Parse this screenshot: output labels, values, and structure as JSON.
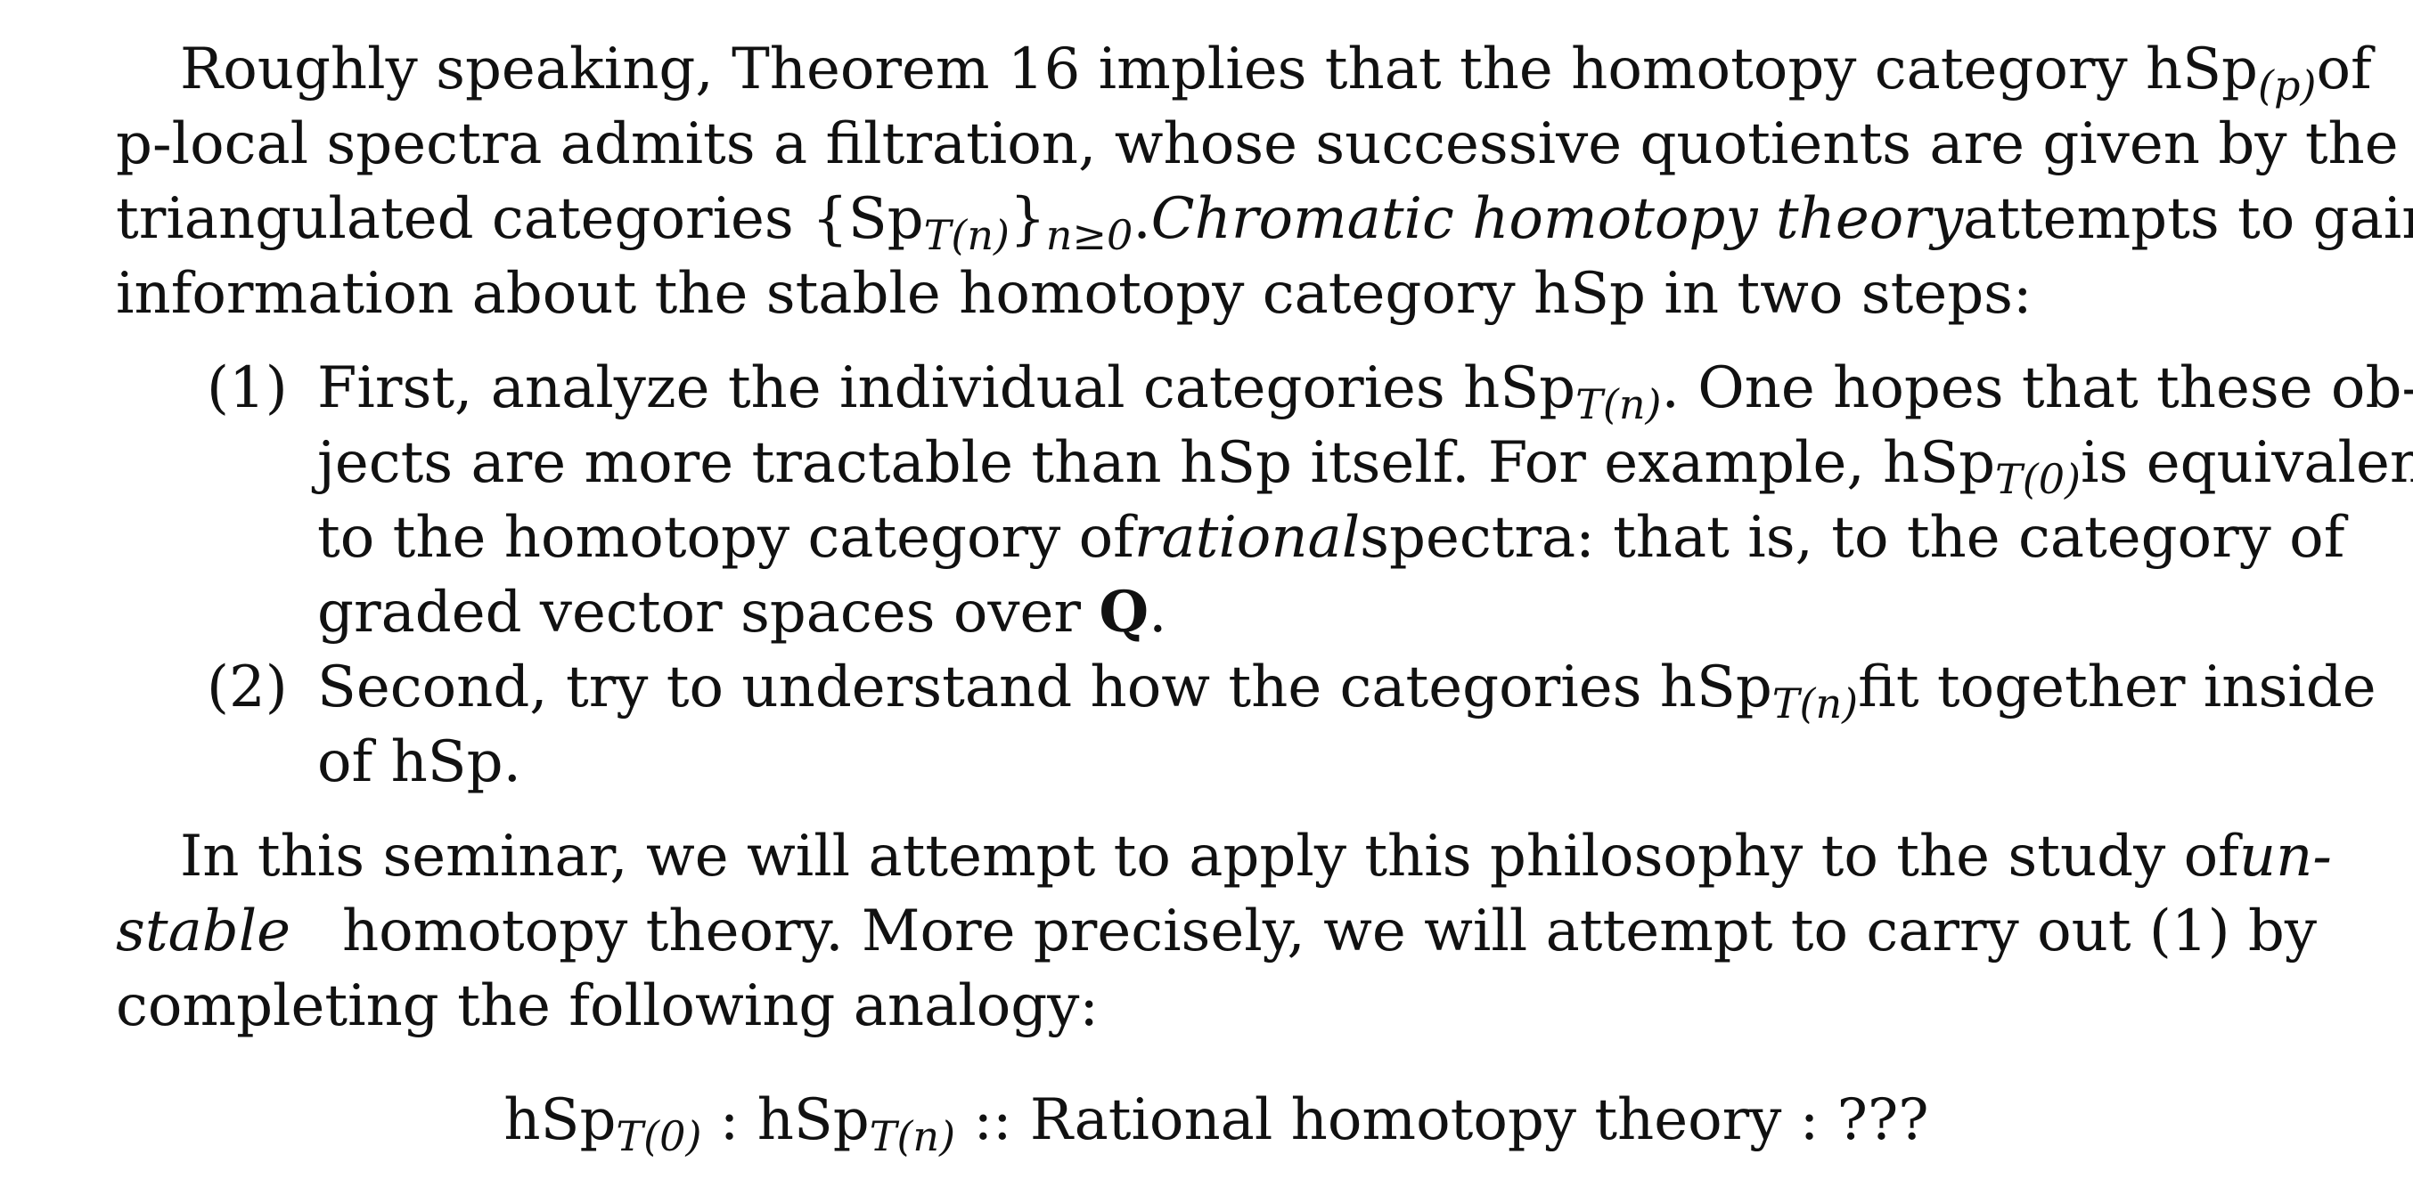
{
  "paragraph1": {
    "line1_a": "Roughly speaking, Theorem 16 implies that the homotopy category hSp",
    "line1_sub": "(p)",
    "line1_b": "of",
    "line2": "p-local spectra admits a filtration, whose successive quotients are given by the",
    "line3_a": "triangulated categories {Sp",
    "line3_sub": "T(n)",
    "line3_b": "}",
    "line3_sub2": "n≥0",
    "line3_c": ".",
    "line3_italic": "Chromatic homotopy theory",
    "line3_d": "attempts to gain",
    "line4": "information about the stable homotopy category hSp in two steps:"
  },
  "list": {
    "item1": {
      "num": "(1)",
      "line1_a": "First, analyze the individual categories hSp",
      "line1_sub": "T(n)",
      "line1_b": ". One hopes that these ob-",
      "line2_a": "jects are more tractable than hSp itself. For example, hSp",
      "line2_sub": "T(0)",
      "line2_b": "is equivalent",
      "line3_a": "to the homotopy category of",
      "line3_italic": "rational",
      "line3_b": "spectra: that is, to the category of",
      "line4_a": "graded vector spaces over",
      "line4_bold": "Q",
      "line4_b": "."
    },
    "item2": {
      "num": "(2)",
      "line1_a": "Second, try to understand how the categories hSp",
      "line1_sub": "T(n)",
      "line1_b": "fit together inside",
      "line2": "of hSp."
    }
  },
  "paragraph2": {
    "line1_a": "In this seminar, we will attempt to apply this philosophy to the study of",
    "line1_italic": "un-",
    "line2_italic": "stable",
    "line2_a": "homotopy theory. More precisely, we will attempt to carry out (1) by",
    "line3": "completing the following analogy:"
  },
  "display_equation": {
    "part1": "hSp",
    "part1_sub": "T(0)",
    "part2": " : hSp",
    "part2_sub": "T(n)",
    "part3": " :: Rational homotopy theory : ???"
  }
}
